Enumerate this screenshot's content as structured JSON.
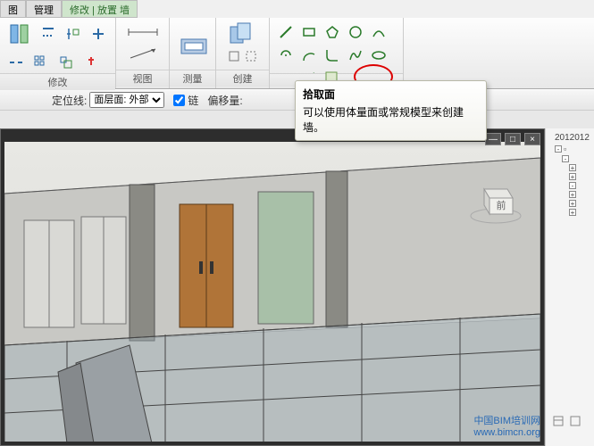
{
  "tabs": {
    "t1": "图",
    "t2": "管理",
    "t3": "修改 | 放置 墙"
  },
  "panels": {
    "modify": "修改",
    "view": "视图",
    "measure": "测量",
    "create": "创建"
  },
  "options": {
    "locate_label": "定位线:",
    "locate_value": "面层面: 外部",
    "chain_label": "链",
    "offset_label": "偏移量:"
  },
  "tooltip": {
    "title": "拾取面",
    "body": "可以使用体量面或常规模型来创建墙。"
  },
  "right_panel": {
    "date": "2012012"
  },
  "viewcube": {
    "face": "前"
  },
  "watermark": {
    "line1": "中国BIM培训网",
    "line2": "www.bimcn.org"
  },
  "window": {
    "min": "—",
    "max": "□",
    "close": "×"
  }
}
